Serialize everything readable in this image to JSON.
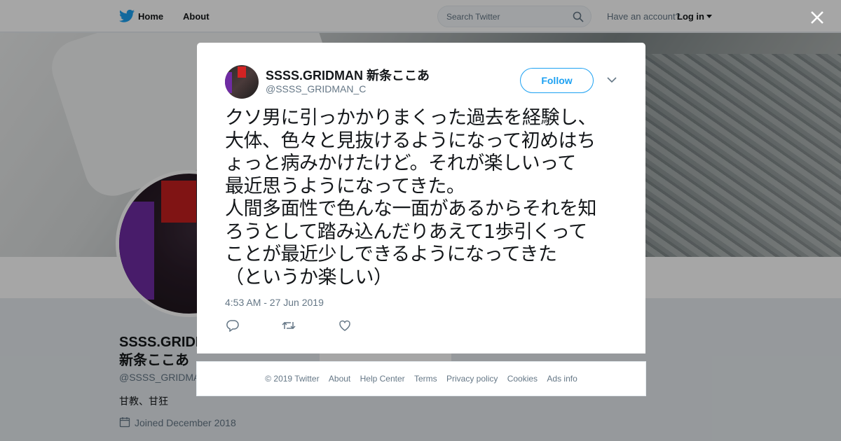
{
  "nav": {
    "home": "Home",
    "about": "About",
    "search_placeholder": "Search Twitter",
    "have_account": "Have an account?",
    "login": "Log in"
  },
  "profile": {
    "name": "SSSS.GRIDMAN 新条ここあ",
    "handle": "@SSSS_GRIDMAN_C",
    "bio": "甘教、甘狂",
    "joined": "Joined December 2018"
  },
  "tweet": {
    "name": "SSSS.GRIDMAN 新条ここあ",
    "handle": "@SSSS_GRIDMAN_C",
    "follow": "Follow",
    "text": "クソ男に引っかかりまくった過去を経験し、\n大体、色々と見抜けるようになって初めはち\nょっと病みかけたけど。それが楽しいって\n最近思うようになってきた。\n人間多面性で色んな一面があるからそれを知\nろうとして踏み込んだりあえて1歩引くって\nことが最近少しできるようになってきた\n（というか楽しい）",
    "timestamp": "4:53 AM - 27 Jun 2019"
  },
  "footer": {
    "copyright": "© 2019 Twitter",
    "about": "About",
    "help": "Help Center",
    "terms": "Terms",
    "privacy": "Privacy policy",
    "cookies": "Cookies",
    "ads": "Ads info"
  },
  "colors": {
    "accent": "#1da1f2",
    "text": "#14171a",
    "muted": "#657786"
  },
  "icons": [
    "twitter-bird-icon",
    "search-icon",
    "caret-down-icon",
    "close-icon",
    "chevron-down-icon",
    "reply-icon",
    "retweet-icon",
    "like-icon",
    "calendar-icon"
  ]
}
